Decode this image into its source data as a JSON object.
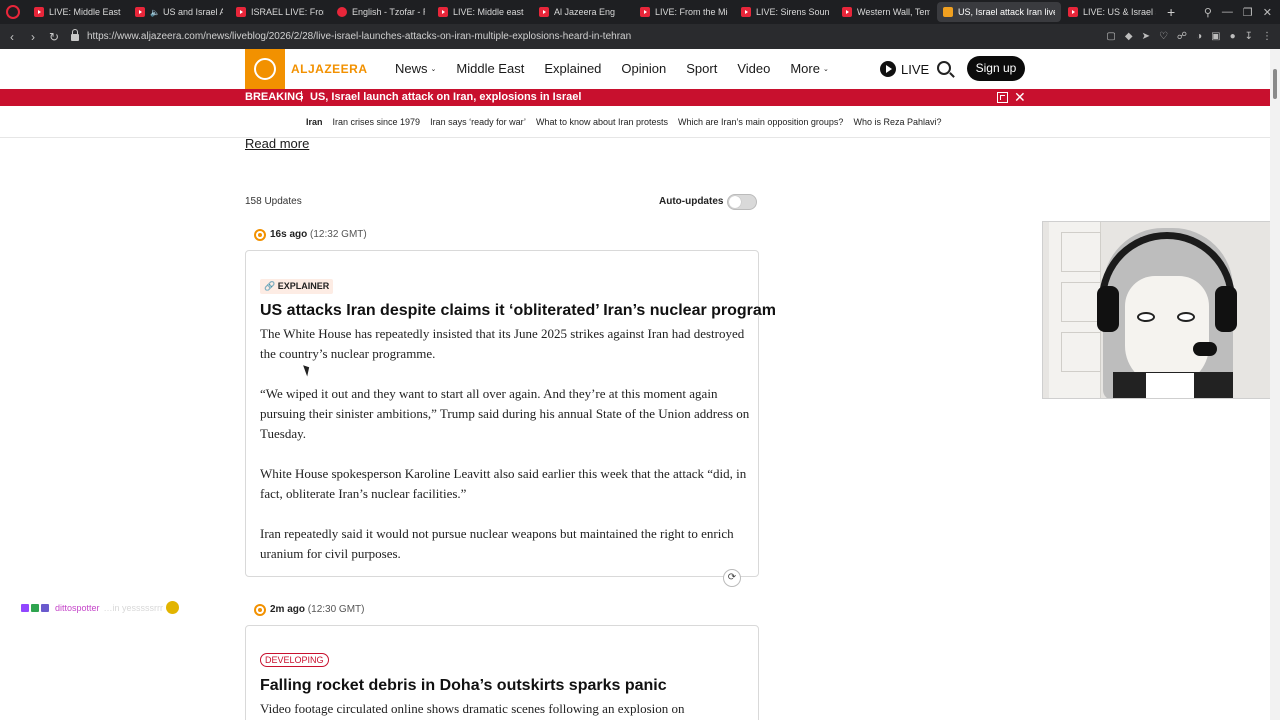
{
  "browser": {
    "tabs": [
      {
        "title": "LIVE: Middle East re",
        "favicon": "youtube-icon"
      },
      {
        "title": "US and Israel A",
        "favicon": "youtube-icon",
        "sound": true
      },
      {
        "title": "ISRAEL LIVE: From",
        "favicon": "youtube-icon"
      },
      {
        "title": "English - Tzofar - R",
        "favicon": "globe-icon"
      },
      {
        "title": "LIVE: Middle east L",
        "favicon": "youtube-icon"
      },
      {
        "title": "Al Jazeera Eng",
        "favicon": "youtube-icon"
      },
      {
        "title": "LIVE: From the Mid",
        "favicon": "youtube-icon"
      },
      {
        "title": "LIVE: Sirens Sound",
        "favicon": "youtube-icon"
      },
      {
        "title": "Western Wall, Temp",
        "favicon": "youtube-icon"
      },
      {
        "title": "US, Israel attack Iran live:",
        "favicon": "aljazeera-icon",
        "active": true
      },
      {
        "title": "LIVE: US & Israel st",
        "favicon": "youtube-icon"
      }
    ],
    "url": "https://www.aljazeera.com/news/liveblog/2026/2/28/live-israel-launches-attacks-on-iran-multiple-explosions-heard-in-tehran"
  },
  "site": {
    "logo_text": "ALJAZEERA",
    "nav": {
      "news": "News",
      "middle_east": "Middle East",
      "explained": "Explained",
      "opinion": "Opinion",
      "sport": "Sport",
      "video": "Video",
      "more": "More"
    },
    "live_label": "LIVE",
    "signup_label": "Sign up",
    "accent_color": "#f29100",
    "breaking_color": "#c8102e"
  },
  "breaking": {
    "label": "BREAKING",
    "separator": "|",
    "text": "US, Israel launch attack on Iran, explosions in Israel"
  },
  "topics": [
    "Iran",
    "Iran crises since 1979",
    "Iran says ‘ready for war’",
    "What to know about Iran protests",
    "Which are Iran’s main opposition groups?",
    "Who is Reza Pahlavi?"
  ],
  "liveblog": {
    "read_more": "Read more",
    "updates_count": "158 Updates",
    "auto_updates_label": "Auto-updates",
    "auto_updates_on": false,
    "posts": [
      {
        "time_ago": "16s ago",
        "time_gmt": "(12:32 GMT)",
        "tag": "EXPLAINER",
        "title": "US attacks Iran despite claims it ‘obliterated’ Iran’s nuclear program",
        "paragraphs": [
          "The White House has repeatedly insisted that its June 2025 strikes against Iran had destroyed the country’s nuclear programme.",
          "“We wiped it out and they want to start all over again. And they’re at this moment again pursuing their sinister ambitions,” Trump said during his annual State of the Union address on Tuesday.",
          "White House spokesperson Karoline Leavitt also said earlier this week that the at­tack “did, in fact, obliterate Iran’s nuclear facilities.”",
          "Iran repeatedly said it would not pursue nuclear weapons but maintained the right to enrich uranium for civil purposes."
        ]
      },
      {
        "time_ago": "2m ago",
        "time_gmt": "(12:30 GMT)",
        "tag": "DEVELOPING",
        "title": "Falling rocket debris in Doha’s outskirts sparks panic",
        "paragraphs": [
          "Video footage circulated online shows dramatic scenes following an explosion on"
        ]
      }
    ]
  },
  "chat": {
    "user": "dittospotter",
    "message": "…in yesssssrrr"
  }
}
